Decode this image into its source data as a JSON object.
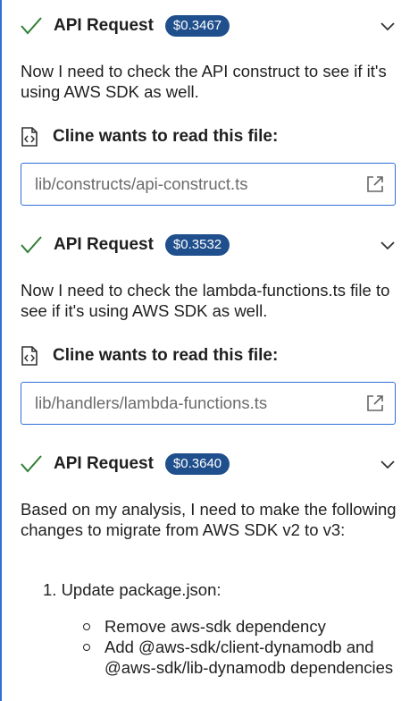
{
  "requests": [
    {
      "title": "API Request",
      "cost": "$0.3467",
      "message": "Now I need to check the API construct to see if it's using AWS SDK as well.",
      "tool_label": "Cline wants to read this file:",
      "file_path": "lib/constructs/api-construct.ts"
    },
    {
      "title": "API Request",
      "cost": "$0.3532",
      "message": "Now I need to check the lambda-functions.ts file to see if it's using AWS SDK as well.",
      "tool_label": "Cline wants to read this file:",
      "file_path": "lib/handlers/lambda-functions.ts"
    },
    {
      "title": "API Request",
      "cost": "$0.3640",
      "message": "Based on my analysis, I need to make the following changes to migrate from AWS SDK v2 to v3:"
    }
  ],
  "plan": {
    "step1": "1. Update package.json:",
    "bullets": [
      "Remove aws-sdk dependency",
      "Add @aws-sdk/client-dynamodb and @aws-sdk/lib-dynamodb dependencies"
    ]
  },
  "icons": {
    "check": "check-icon",
    "chevron": "chevron-down-icon",
    "file": "file-code-icon",
    "open": "open-external-icon"
  },
  "colors": {
    "accent": "#2f6fd6",
    "cost_badge": "#1f4f8c",
    "path_text": "#6b6b6b"
  }
}
